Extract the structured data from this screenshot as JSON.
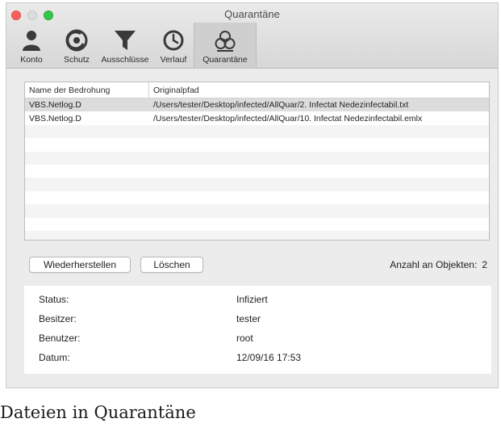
{
  "window": {
    "title": "Quarantäne"
  },
  "tabs": [
    {
      "label": "Konto",
      "icon": "user-icon"
    },
    {
      "label": "Schutz",
      "icon": "shield-icon"
    },
    {
      "label": "Ausschlüsse",
      "icon": "funnel-icon"
    },
    {
      "label": "Verlauf",
      "icon": "clock-icon"
    },
    {
      "label": "Quarantäne",
      "icon": "biohazard-icon",
      "active": true
    }
  ],
  "table": {
    "columns": [
      "Name der Bedrohung",
      "Originalpfad"
    ],
    "rows": [
      {
        "name": "VBS.Netlog.D",
        "path": "/Users/tester/Desktop/infected/AllQuar/2. Infectat Nedezinfectabil.txt",
        "selected": true
      },
      {
        "name": "VBS.Netlog.D",
        "path": "/Users/tester/Desktop/infected/AllQuar/10. Infectat Nedezinfectabil.emlx",
        "selected": false
      }
    ]
  },
  "buttons": {
    "restore": "Wiederherstellen",
    "delete": "Löschen"
  },
  "count": {
    "label": "Anzahl an Objekten:",
    "value": "2"
  },
  "details": [
    {
      "label": "Status:",
      "value": "Infiziert"
    },
    {
      "label": "Besitzer:",
      "value": "tester"
    },
    {
      "label": "Benutzer:",
      "value": "root"
    },
    {
      "label": "Datum:",
      "value": "12/09/16 17:53"
    }
  ],
  "caption": "Dateien in Quarantäne",
  "colors": {
    "close": "#fc605c",
    "zoom": "#34c84a",
    "selected_row": "#dcdcdc"
  }
}
